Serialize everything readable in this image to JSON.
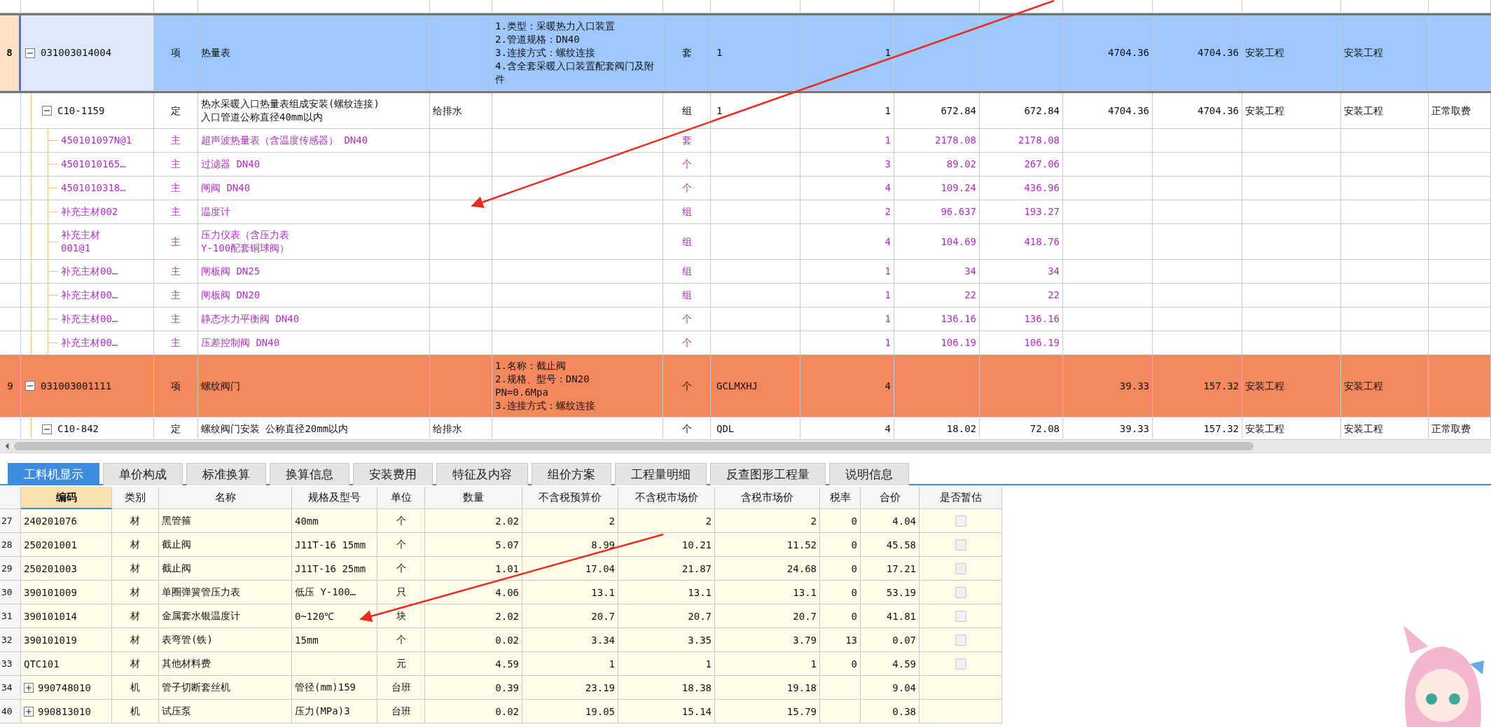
{
  "top_table": {
    "rows": [
      {
        "number": "8",
        "code": "031003014004",
        "kind": "item",
        "selected": true,
        "expanded": true,
        "cells": [
          "项",
          "热量表",
          null,
          "1.类型：采暖热力入口装置\n2.管道规格：DN40\n3.连接方式：螺纹连接\n4.含全套采暖入口装置配套阀门及附件",
          "套",
          "1",
          "1",
          null,
          null,
          "4704.36",
          "4704.36",
          "安装工程",
          "安装工程",
          null
        ],
        "children": [
          {
            "code": "C10-1159",
            "kind": "quota",
            "selected": false,
            "expanded": true,
            "cells": [
              "定",
              "热水采暖入口热量表组成安装(螺纹连接)\n入口管道公称直径40mm以内",
              "给排水",
              null,
              "组",
              "1",
              "1",
              "672.84",
              "672.84",
              "4704.36",
              "4704.36",
              "安装工程",
              "安装工程",
              "正常取费"
            ],
            "children": [
              {
                "code": "450101097N@1",
                "kind": "material",
                "selected": false,
                "cells": [
                  "主",
                  "超声波热量表（含温度传感器） DN40",
                  null,
                  null,
                  "套",
                  null,
                  "1",
                  "2178.08",
                  "2178.08",
                  null,
                  null,
                  null,
                  null,
                  null
                ]
              },
              {
                "code": "4501010165…",
                "kind": "material",
                "selected": false,
                "cells": [
                  "主",
                  "过滤器  DN40",
                  null,
                  null,
                  "个",
                  null,
                  "3",
                  "89.02",
                  "267.06",
                  null,
                  null,
                  null,
                  null,
                  null
                ]
              },
              {
                "code": "4501010318…",
                "kind": "material",
                "selected": false,
                "cells": [
                  "主",
                  "闸阀  DN40",
                  null,
                  null,
                  "个",
                  null,
                  "4",
                  "109.24",
                  "436.96",
                  null,
                  null,
                  null,
                  null,
                  null
                ]
              },
              {
                "code": "补充主材002",
                "kind": "material",
                "selected": false,
                "cells": [
                  "主",
                  "温度计",
                  null,
                  null,
                  "组",
                  null,
                  "2",
                  "96.637",
                  "193.27",
                  null,
                  null,
                  null,
                  null,
                  null
                ]
              },
              {
                "code": "补充主材\n001@1",
                "kind": "material",
                "selected": false,
                "cells": [
                  "主",
                  "压力仪表（含压力表\nY-100配套铜球阀）",
                  null,
                  null,
                  "组",
                  null,
                  "4",
                  "104.69",
                  "418.76",
                  null,
                  null,
                  null,
                  null,
                  null
                ]
              },
              {
                "code": "补充主材00…",
                "kind": "material",
                "selected": false,
                "cells": [
                  "主",
                  "闸板阀 DN25",
                  null,
                  null,
                  "组",
                  null,
                  "1",
                  "34",
                  "34",
                  null,
                  null,
                  null,
                  null,
                  null
                ]
              },
              {
                "code": "补充主材00…",
                "kind": "material",
                "selected": false,
                "cells": [
                  "主",
                  "闸板阀 DN20",
                  null,
                  null,
                  "组",
                  null,
                  "1",
                  "22",
                  "22",
                  null,
                  null,
                  null,
                  null,
                  null
                ]
              },
              {
                "code": "补充主材00…",
                "kind": "material",
                "selected": false,
                "cells": [
                  "主",
                  "静态水力平衡阀  DN40",
                  null,
                  null,
                  "个",
                  null,
                  "1",
                  "136.16",
                  "136.16",
                  null,
                  null,
                  null,
                  null,
                  null
                ]
              },
              {
                "code": "补充主材00…",
                "kind": "material",
                "selected": false,
                "cells": [
                  "主",
                  "压差控制阀  DN40",
                  null,
                  null,
                  "个",
                  null,
                  "1",
                  "106.19",
                  "106.19",
                  null,
                  null,
                  null,
                  null,
                  null
                ]
              }
            ]
          }
        ]
      },
      {
        "number": "9",
        "code": "031003001111",
        "kind": "item",
        "selected": false,
        "expanded": true,
        "color": "#f5875c",
        "cells": [
          "项",
          "螺纹阀门",
          null,
          "1.名称：截止阀\n2.规格、型号：DN20\nPN=0.6Mpa\n3.连接方式：螺纹连接",
          "个",
          "GCLMXHJ",
          "4",
          null,
          null,
          "39.33",
          "157.32",
          "安装工程",
          "安装工程",
          null
        ],
        "children": [
          {
            "code": "C10-842",
            "kind": "quota",
            "selected": false,
            "expanded": true,
            "cells": [
              "定",
              "螺纹阀门安装 公称直径20mm以内",
              "给排水",
              null,
              "个",
              "QDL",
              "4",
              "18.02",
              "72.08",
              "39.33",
              "157.32",
              "安装工程",
              "安装工程",
              "正常取费"
            ]
          }
        ]
      }
    ]
  },
  "tabs": [
    {
      "label": "工料机显示",
      "selected": true
    },
    {
      "label": "单价构成",
      "selected": false
    },
    {
      "label": "标准换算",
      "selected": false
    },
    {
      "label": "换算信息",
      "selected": false
    },
    {
      "label": "安装费用",
      "selected": false
    },
    {
      "label": "特征及内容",
      "selected": false
    },
    {
      "label": "组价方案",
      "selected": false
    },
    {
      "label": "工程量明细",
      "selected": false
    },
    {
      "label": "反查图形工程量",
      "selected": false
    },
    {
      "label": "说明信息",
      "selected": false
    }
  ],
  "resource_table": {
    "columns": [
      {
        "label": "编码",
        "selected": true
      },
      {
        "label": "类别",
        "selected": false
      },
      {
        "label": "名称",
        "selected": false
      },
      {
        "label": "规格及型号",
        "selected": false
      },
      {
        "label": "单位",
        "selected": false
      },
      {
        "label": "数量",
        "selected": false
      },
      {
        "label": "不含税预算价",
        "selected": false
      },
      {
        "label": "不含税市场价",
        "selected": false
      },
      {
        "label": "含税市场价",
        "selected": false
      },
      {
        "label": "税率",
        "selected": false
      },
      {
        "label": "合价",
        "selected": false
      },
      {
        "label": "是否暂估",
        "selected": false
      }
    ],
    "rows": [
      {
        "number": "27",
        "kind": "material",
        "estimated": false,
        "cells": [
          "240201076",
          "材",
          "黑管箍",
          "40mm",
          "个",
          "2.02",
          "2",
          "2",
          "2",
          "0",
          "4.04"
        ]
      },
      {
        "number": "28",
        "kind": "material",
        "estimated": false,
        "cells": [
          "250201001",
          "材",
          "截止阀",
          "J11T-16 15mm",
          "个",
          "5.07",
          "8.99",
          "10.21",
          "11.52",
          "0",
          "45.58"
        ]
      },
      {
        "number": "29",
        "kind": "material",
        "estimated": false,
        "cells": [
          "250201003",
          "材",
          "截止阀",
          "J11T-16 25mm",
          "个",
          "1.01",
          "17.04",
          "21.87",
          "24.68",
          "0",
          "17.21"
        ]
      },
      {
        "number": "30",
        "kind": "material",
        "estimated": false,
        "cells": [
          "390101009",
          "材",
          "单圈弹簧管压力表",
          "低压 Y-100…",
          "只",
          "4.06",
          "13.1",
          "13.1",
          "13.1",
          "0",
          "53.19"
        ]
      },
      {
        "number": "31",
        "kind": "material",
        "estimated": false,
        "cells": [
          "390101014",
          "材",
          "金属套水银温度计",
          "0~120℃",
          "块",
          "2.02",
          "20.7",
          "20.7",
          "20.7",
          "0",
          "41.81"
        ]
      },
      {
        "number": "32",
        "kind": "material",
        "estimated": false,
        "cells": [
          "390101019",
          "材",
          "表弯管(铁)",
          "15mm",
          "个",
          "0.02",
          "3.34",
          "3.35",
          "3.79",
          "13",
          "0.07"
        ]
      },
      {
        "number": "33",
        "kind": "material",
        "estimated": false,
        "cells": [
          "QTC101",
          "材",
          "其他材料费",
          null,
          "元",
          "4.59",
          "1",
          "1",
          "1",
          "0",
          "4.59"
        ]
      },
      {
        "number": "34",
        "kind": "machine",
        "expanded": false,
        "cells": [
          "990748010",
          "机",
          "管子切断套丝机",
          "管径(mm)159",
          "台班",
          "0.39",
          "23.19",
          "18.38",
          "19.18",
          null,
          "9.04"
        ]
      },
      {
        "number": "40",
        "kind": "machine",
        "expanded": false,
        "cells": [
          "990813010",
          "机",
          "试压泵",
          "压力(MPa)3",
          "台班",
          "0.02",
          "19.05",
          "15.14",
          "15.79",
          null,
          "0.38"
        ]
      }
    ]
  }
}
